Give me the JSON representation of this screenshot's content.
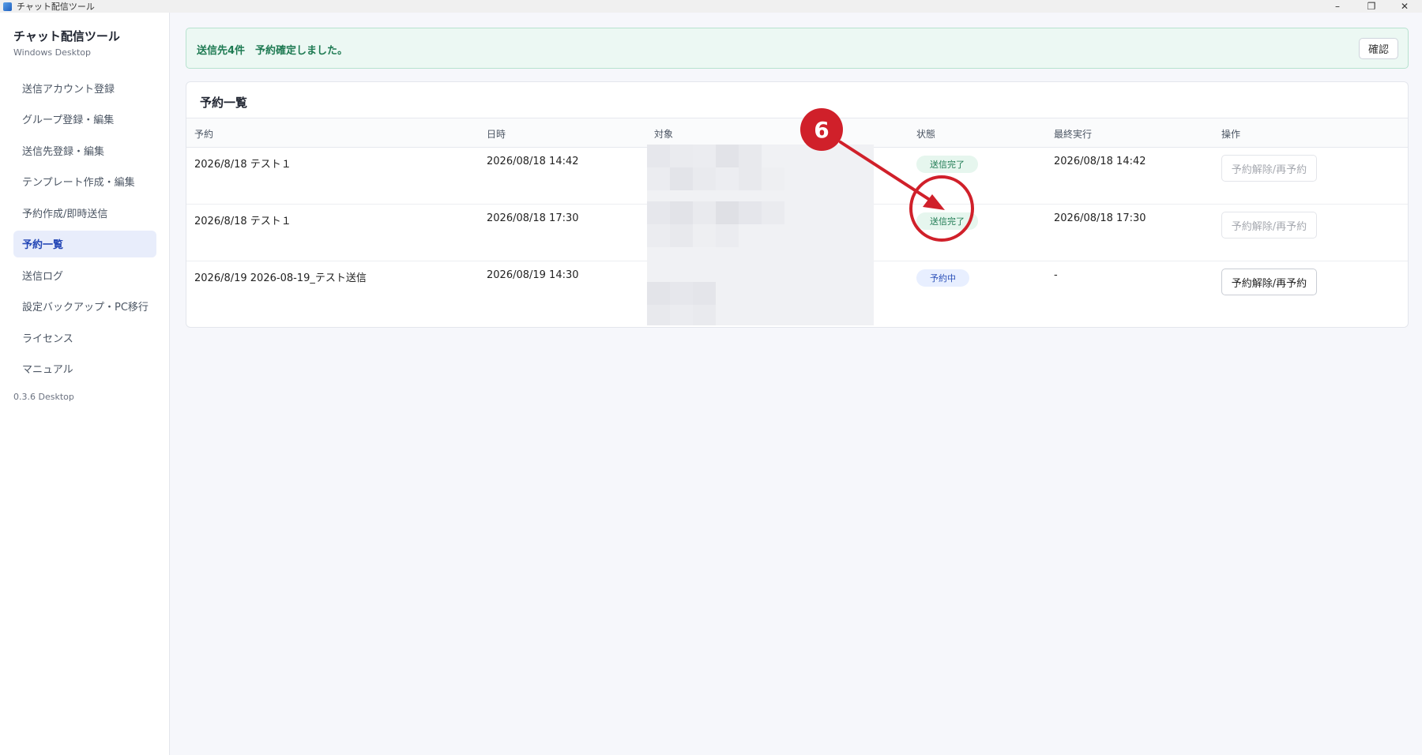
{
  "window": {
    "title": "チャット配信ツール",
    "minimize": "–",
    "restore": "❐",
    "close": "✕"
  },
  "sidebar": {
    "brand_title": "チャット配信ツール",
    "brand_subtitle": "Windows Desktop",
    "items": [
      {
        "label": "送信アカウント登録"
      },
      {
        "label": "グループ登録・編集"
      },
      {
        "label": "送信先登録・編集"
      },
      {
        "label": "テンプレート作成・編集"
      },
      {
        "label": "予約作成/即時送信"
      },
      {
        "label": "予約一覧"
      },
      {
        "label": "送信ログ"
      },
      {
        "label": "設定バックアップ・PC移行"
      },
      {
        "label": "ライセンス"
      },
      {
        "label": "マニュアル"
      }
    ],
    "active_item": "予約一覧",
    "version": "0.3.6 Desktop"
  },
  "banner": {
    "message": "送信先4件　予約確定しました。",
    "confirm_label": "確認"
  },
  "reservations": {
    "title": "予約一覧",
    "columns": [
      "予約",
      "日時",
      "対象",
      "状態",
      "最終実行",
      "操作"
    ],
    "rows": [
      {
        "name": "2026/8/18 テスト１",
        "datetime": "2026/08/18 14:42",
        "status": "送信完了",
        "last_run": "2026/08/18 14:42",
        "action": "予約解除/再予約"
      },
      {
        "name": "2026/8/18 テスト１",
        "datetime": "2026/08/18 17:30",
        "status": "送信完了",
        "last_run": "2026/08/18 17:30",
        "action": "予約解除/再予約"
      },
      {
        "name": "2026/8/19 2026-08-19_テスト送信",
        "datetime": "2026/08/19 14:30",
        "status": "予約中",
        "last_run": "-",
        "action": "予約解除/再予約"
      }
    ]
  },
  "annotation": {
    "step_number": "6",
    "color": "#d0202a"
  },
  "colors": {
    "accent": "#2447b6",
    "success_text": "#1e7a52",
    "success_bg": "#ecf8f3"
  }
}
